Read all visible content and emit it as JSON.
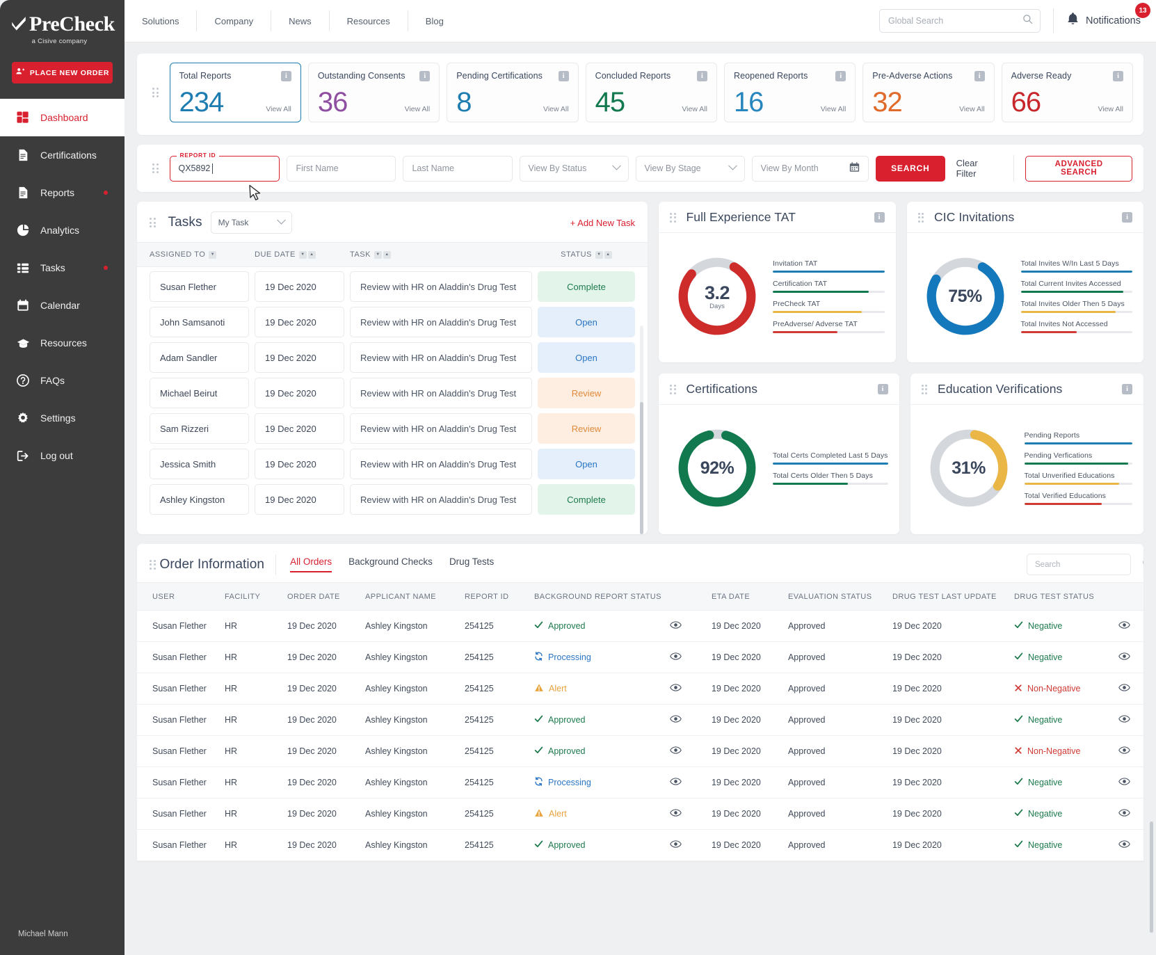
{
  "brand": {
    "name": "PreCheck",
    "tagline": "a Cisive company",
    "accent": "#d8202f",
    "place_order_label": "PLACE NEW ORDER"
  },
  "sidebar": {
    "items": [
      {
        "label": "Dashboard",
        "icon": "grid-icon",
        "active": true,
        "dot": false
      },
      {
        "label": "Certifications",
        "icon": "document-icon",
        "active": false,
        "dot": false
      },
      {
        "label": "Reports",
        "icon": "report-icon",
        "active": false,
        "dot": true
      },
      {
        "label": "Analytics",
        "icon": "pie-chart-icon",
        "active": false,
        "dot": false
      },
      {
        "label": "Tasks",
        "icon": "list-icon",
        "active": false,
        "dot": true
      },
      {
        "label": "Calendar",
        "icon": "calendar-icon",
        "active": false,
        "dot": false
      },
      {
        "label": "Resources",
        "icon": "graduation-cap-icon",
        "active": false,
        "dot": false
      },
      {
        "label": "FAQs",
        "icon": "question-circle-icon",
        "active": false,
        "dot": false
      },
      {
        "label": "Settings",
        "icon": "gear-icon",
        "active": false,
        "dot": false
      },
      {
        "label": "Log out",
        "icon": "logout-icon",
        "active": false,
        "dot": false
      }
    ],
    "user": "Michael Mann"
  },
  "topbar": {
    "nav": [
      "Solutions",
      "Company",
      "News",
      "Resources",
      "Blog"
    ],
    "search_placeholder": "Global Search",
    "search_value": "",
    "notifications_label": "Notifications",
    "notifications_count": "13"
  },
  "kpis": [
    {
      "title": "Total Reports",
      "value": "234",
      "color": "#1d7db1",
      "view_all": "View All",
      "selected": true
    },
    {
      "title": "Outstanding Consents",
      "value": "36",
      "color": "#8e4fa0",
      "view_all": "View All",
      "selected": false
    },
    {
      "title": "Pending Certifications",
      "value": "8",
      "color": "#1d7db1",
      "view_all": "View All",
      "selected": false
    },
    {
      "title": "Concluded Reports",
      "value": "45",
      "color": "#12794f",
      "view_all": "View All",
      "selected": false
    },
    {
      "title": "Reopened Reports",
      "value": "16",
      "color": "#2686bd",
      "view_all": "View All",
      "selected": false
    },
    {
      "title": "Pre-Adverse Actions",
      "value": "32",
      "color": "#e06a29",
      "view_all": "View All",
      "selected": false
    },
    {
      "title": "Adverse Ready",
      "value": "66",
      "color": "#c7262b",
      "view_all": "View All",
      "selected": false
    }
  ],
  "filters": {
    "report_id_legend": "REPORT ID",
    "report_id_value": "QX5892",
    "first_name_placeholder": "First Name",
    "last_name_placeholder": "Last Name",
    "status_placeholder": "View By Status",
    "stage_placeholder": "View By Stage",
    "month_placeholder": "View By Month",
    "search_label": "SEARCH",
    "clear_label": "Clear Filter",
    "advanced_label": "ADVANCED SEARCH"
  },
  "tasks": {
    "title": "Tasks",
    "selector_value": "My Task",
    "add_label": "+ Add New Task",
    "columns": [
      "ASSIGNED TO",
      "DUE DATE",
      "TASK",
      "STATUS"
    ],
    "rows": [
      {
        "assigned": "Susan Flether",
        "due": "19 Dec 2020",
        "task": "Review with HR on Aladdin's Drug Test",
        "status": "Complete",
        "status_class": "st-complete"
      },
      {
        "assigned": "John Samsanoti",
        "due": "19 Dec 2020",
        "task": "Review with HR on Aladdin's Drug Test",
        "status": "Open",
        "status_class": "st-open"
      },
      {
        "assigned": "Adam Sandler",
        "due": "19 Dec 2020",
        "task": "Review with HR on Aladdin's Drug Test",
        "status": "Open",
        "status_class": "st-open"
      },
      {
        "assigned": "Michael Beirut",
        "due": "19 Dec 2020",
        "task": "Review with HR on Aladdin's Drug Test",
        "status": "Review",
        "status_class": "st-review"
      },
      {
        "assigned": "Sam Rizzeri",
        "due": "19 Dec 2020",
        "task": "Review with HR on Aladdin's Drug Test",
        "status": "Review",
        "status_class": "st-review"
      },
      {
        "assigned": "Jessica Smith",
        "due": "19 Dec 2020",
        "task": "Review with HR on Aladdin's Drug Test",
        "status": "Open",
        "status_class": "st-open"
      },
      {
        "assigned": "Ashley Kingston",
        "due": "19 Dec 2020",
        "task": "Review with HR on Aladdin's Drug Test",
        "status": "Complete",
        "status_class": "st-complete"
      }
    ]
  },
  "chart_data": [
    {
      "type": "pie",
      "title": "Full Experience TAT",
      "center_value": "3.2",
      "center_unit": "Days",
      "percent": 78,
      "ring_color": "#ce2b2b",
      "track_color": "#d4d7db",
      "metrics": [
        {
          "label": "Invitation TAT",
          "value": 100,
          "color": "#1d7db1"
        },
        {
          "label": "Certification TAT",
          "value": 86,
          "color": "#12794f"
        },
        {
          "label": "PreCheck TAT",
          "value": 80,
          "color": "#eab646"
        },
        {
          "label": "PreAdverse/ Adverse TAT",
          "value": 58,
          "color": "#cf3b34"
        }
      ]
    },
    {
      "type": "pie",
      "title": "CIC Invitations",
      "center_value": "75%",
      "center_unit": "",
      "percent": 75,
      "ring_color": "#1478bc",
      "track_color": "#d4d7db",
      "metrics": [
        {
          "label": "Total Invites W/In Last 5 Days",
          "value": 100,
          "color": "#1d7db1"
        },
        {
          "label": "Total Current Invites Accessed",
          "value": 92,
          "color": "#12794f"
        },
        {
          "label": "Total Invites Older Then 5 Days",
          "value": 85,
          "color": "#eab646"
        },
        {
          "label": "Total Invites Not Accessed",
          "value": 50,
          "color": "#cf3b34"
        }
      ]
    },
    {
      "type": "pie",
      "title": "Certifications",
      "center_value": "92%",
      "center_unit": "",
      "percent": 92,
      "ring_color": "#12794f",
      "track_color": "#d4d7db",
      "metrics": [
        {
          "label": "Total Certs Completed Last 5 Days",
          "value": 100,
          "color": "#1d7db1"
        },
        {
          "label": "Total Certs Older Then 5 Days",
          "value": 65,
          "color": "#12794f"
        }
      ]
    },
    {
      "type": "pie",
      "title": "Education Verifications",
      "center_value": "31%",
      "center_unit": "",
      "percent": 31,
      "ring_color": "#eab646",
      "track_color": "#d4d7db",
      "metrics": [
        {
          "label": "Pending Reports",
          "value": 100,
          "color": "#1d7db1"
        },
        {
          "label": "Pending Verfications",
          "value": 96,
          "color": "#12794f"
        },
        {
          "label": "Total Unverified Educations",
          "value": 88,
          "color": "#eab646"
        },
        {
          "label": "Total Verified Educations",
          "value": 72,
          "color": "#cf3b34"
        }
      ]
    }
  ],
  "order_information": {
    "title": "Order Information",
    "tabs": [
      {
        "label": "All Orders",
        "active": true
      },
      {
        "label": "Background Checks",
        "active": false
      },
      {
        "label": "Drug Tests",
        "active": false
      }
    ],
    "search_placeholder": "Search",
    "columns": [
      "USER",
      "FACILITY",
      "ORDER DATE",
      "APPLICANT NAME",
      "REPORT ID",
      "BACKGROUND REPORT STATUS",
      "",
      "ETA DATE",
      "EVALUATION STATUS",
      "DRUG TEST LAST UPDATE",
      "DRUG TEST STATUS",
      ""
    ],
    "rows": [
      {
        "user": "Susan Flether",
        "facility": "HR",
        "order_date": "19 Dec 2020",
        "applicant": "Ashley Kingston",
        "report_id": "254125",
        "bg_status": "Approved",
        "bg_icon": "check-icon",
        "eta": "19 Dec 2020",
        "eval": "Approved",
        "dt_update": "19 Dec 2020",
        "dt_status": "Negative",
        "dt_icon": "check-icon"
      },
      {
        "user": "Susan Flether",
        "facility": "HR",
        "order_date": "19 Dec 2020",
        "applicant": "Ashley Kingston",
        "report_id": "254125",
        "bg_status": "Processing",
        "bg_icon": "refresh-icon",
        "eta": "19 Dec 2020",
        "eval": "Approved",
        "dt_update": "19 Dec 2020",
        "dt_status": "Negative",
        "dt_icon": "check-icon"
      },
      {
        "user": "Susan Flether",
        "facility": "HR",
        "order_date": "19 Dec 2020",
        "applicant": "Ashley Kingston",
        "report_id": "254125",
        "bg_status": "Alert",
        "bg_icon": "warning-icon",
        "eta": "19 Dec 2020",
        "eval": "Approved",
        "dt_update": "19 Dec 2020",
        "dt_status": "Non-Negative",
        "dt_icon": "cross-icon"
      },
      {
        "user": "Susan Flether",
        "facility": "HR",
        "order_date": "19 Dec 2020",
        "applicant": "Ashley Kingston",
        "report_id": "254125",
        "bg_status": "Approved",
        "bg_icon": "check-icon",
        "eta": "19 Dec 2020",
        "eval": "Approved",
        "dt_update": "19 Dec 2020",
        "dt_status": "Negative",
        "dt_icon": "check-icon"
      },
      {
        "user": "Susan Flether",
        "facility": "HR",
        "order_date": "19 Dec 2020",
        "applicant": "Ashley Kingston",
        "report_id": "254125",
        "bg_status": "Approved",
        "bg_icon": "check-icon",
        "eta": "19 Dec 2020",
        "eval": "Approved",
        "dt_update": "19 Dec 2020",
        "dt_status": "Non-Negative",
        "dt_icon": "cross-icon"
      },
      {
        "user": "Susan Flether",
        "facility": "HR",
        "order_date": "19 Dec 2020",
        "applicant": "Ashley Kingston",
        "report_id": "254125",
        "bg_status": "Processing",
        "bg_icon": "refresh-icon",
        "eta": "19 Dec 2020",
        "eval": "Approved",
        "dt_update": "19 Dec 2020",
        "dt_status": "Negative",
        "dt_icon": "check-icon"
      },
      {
        "user": "Susan Flether",
        "facility": "HR",
        "order_date": "19 Dec 2020",
        "applicant": "Ashley Kingston",
        "report_id": "254125",
        "bg_status": "Alert",
        "bg_icon": "warning-icon",
        "eta": "19 Dec 2020",
        "eval": "Approved",
        "dt_update": "19 Dec 2020",
        "dt_status": "Negative",
        "dt_icon": "check-icon"
      },
      {
        "user": "Susan Flether",
        "facility": "HR",
        "order_date": "19 Dec 2020",
        "applicant": "Ashley Kingston",
        "report_id": "254125",
        "bg_status": "Approved",
        "bg_icon": "check-icon",
        "eta": "19 Dec 2020",
        "eval": "Approved",
        "dt_update": "19 Dec 2020",
        "dt_status": "Negative",
        "dt_icon": "check-icon"
      }
    ]
  }
}
